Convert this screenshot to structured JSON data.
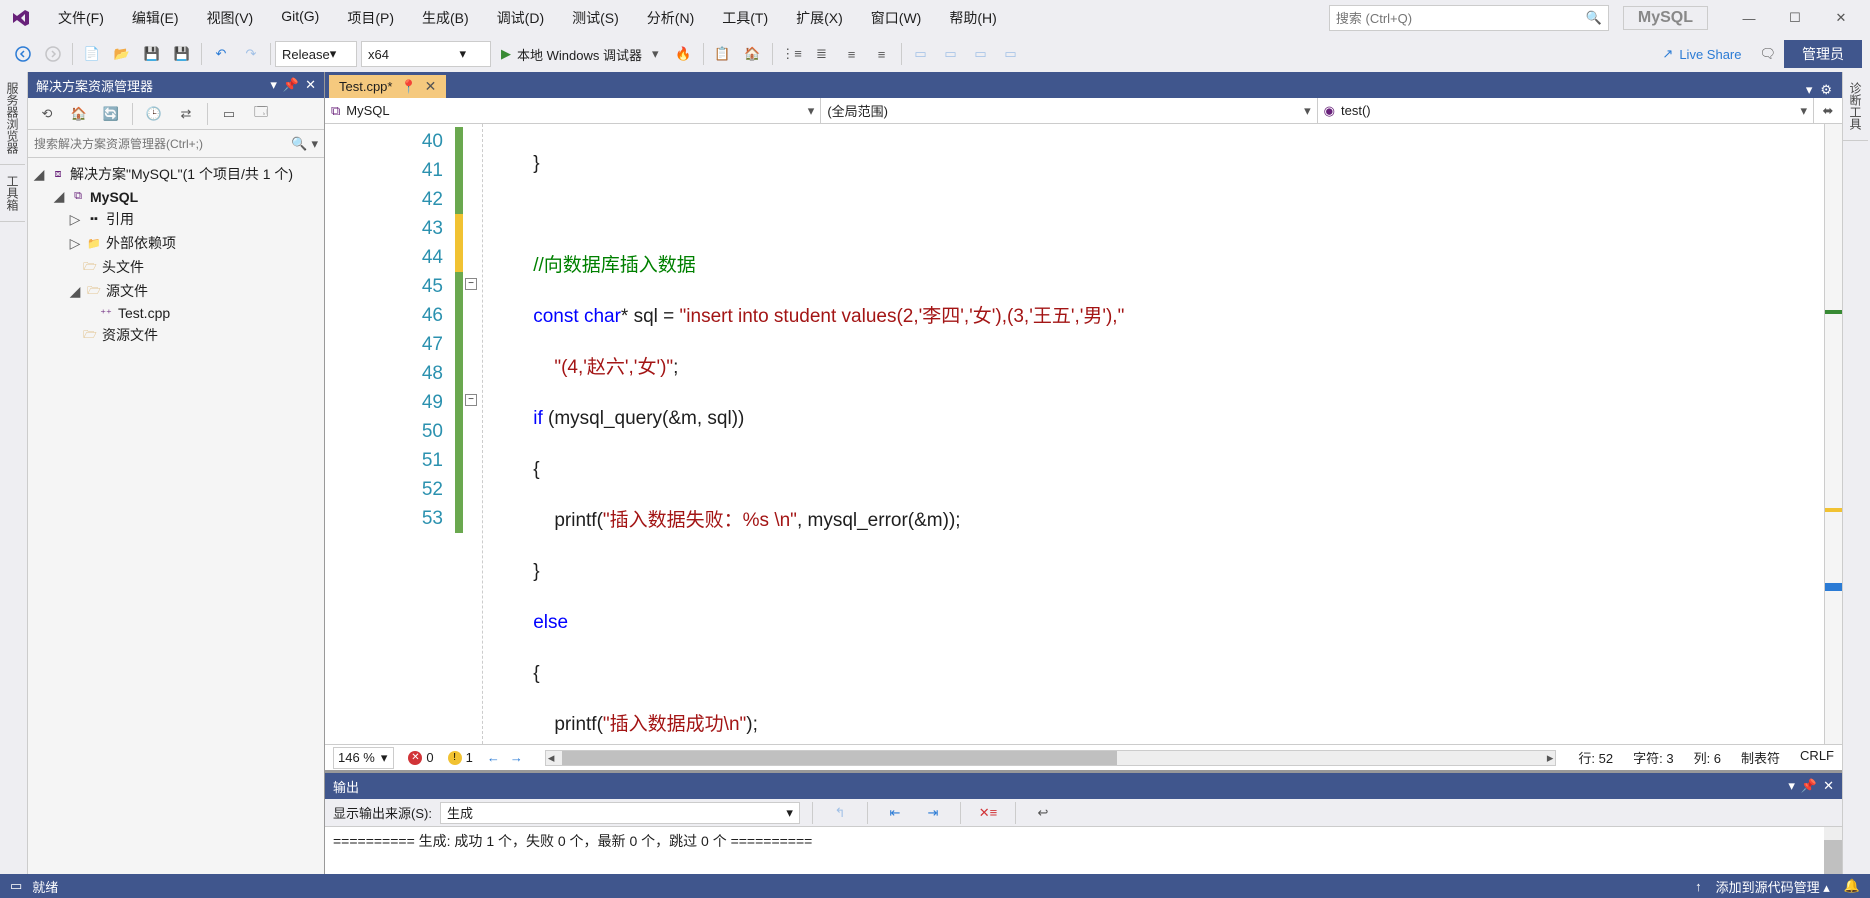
{
  "title": {
    "solution": "MySQL"
  },
  "menu": [
    "文件(F)",
    "编辑(E)",
    "视图(V)",
    "Git(G)",
    "项目(P)",
    "生成(B)",
    "调试(D)",
    "测试(S)",
    "分析(N)",
    "工具(T)",
    "扩展(X)",
    "窗口(W)",
    "帮助(H)"
  ],
  "search_placeholder": "搜索 (Ctrl+Q)",
  "toolbar": {
    "config": "Release",
    "platform": "x64",
    "debug_label": "本地 Windows 调试器",
    "liveshare": "Live Share",
    "admin": "管理员"
  },
  "left_tabs": [
    "服务器浏览器",
    "工具箱"
  ],
  "right_tabs": [
    "诊断工具"
  ],
  "solution_explorer": {
    "title": "解决方案资源管理器",
    "search_placeholder": "搜索解决方案资源管理器(Ctrl+;)",
    "root": "解决方案\"MySQL\"(1 个项目/共 1 个)",
    "project": "MySQL",
    "items": [
      "引用",
      "外部依赖项",
      "头文件",
      "源文件",
      "资源文件"
    ],
    "source_file": "Test.cpp"
  },
  "editor": {
    "tab": "Test.cpp*",
    "nav": {
      "project": "MySQL",
      "scope": "(全局范围)",
      "member": "test()"
    },
    "line_start": 40,
    "line_end": 53,
    "lines": [
      "            }",
      "",
      "            //向数据库插入数据",
      "            const char* sql = \"insert into student values(2,'李四','女'),(3,'王五','男'),\"",
      "                \"(4,'赵六','女')\";",
      "            if (mysql_query(&m, sql))",
      "            {",
      "                printf(\"插入数据失败：%s \\n\", mysql_error(&m));",
      "            }",
      "            else",
      "            {",
      "                printf(\"插入数据成功\\n\");",
      "            }",
      ""
    ],
    "zoom": "146 %",
    "errors": "0",
    "warnings": "1",
    "status": {
      "line": "行: 52",
      "col": "字符: 3",
      "pos": "列: 6",
      "tab": "制表符",
      "eol": "CRLF"
    }
  },
  "output": {
    "title": "输出",
    "source_label": "显示输出来源(S):",
    "source": "生成",
    "line1": "==========",
    "line2": "生成: 成功 1 个，失败 0 个，最新 0 个，跳过 0 个 ==========",
    "full": "========== 生成: 成功 1 个，失败 0 个，最新 0 个，跳过 0 个 =========="
  },
  "statusbar": {
    "ready": "就绪",
    "scm": "添加到源代码管理"
  }
}
